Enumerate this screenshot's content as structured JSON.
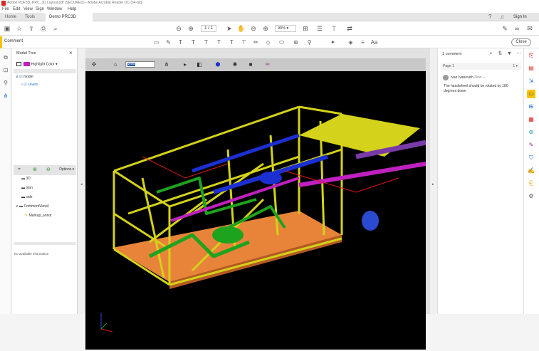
{
  "window": {
    "title": "Adobe PDF3D_PRC_3D Layout.pdf (SECURED) - Adobe Acrobat Reader DC (64-bit)",
    "accent": "#d9261c"
  },
  "menu": [
    "File",
    "Edit",
    "View",
    "Sign",
    "Window",
    "Help"
  ],
  "tabs": [
    {
      "label": "Home"
    },
    {
      "label": "Tools"
    },
    {
      "label": "Demo PRC3D Befo..."
    }
  ],
  "header": {
    "signin": "Sign In"
  },
  "toolbar": {
    "page_current": "1",
    "page_total": "/ 1",
    "zoom": "90%"
  },
  "commentbar": {
    "label": "Comment",
    "close": "Close",
    "accent": "#f7c200"
  },
  "modeltree": {
    "title": "Model Tree",
    "color_label": "Highlight Color",
    "tree": [
      {
        "label": "model",
        "level": 0,
        "checked": true
      },
      {
        "label": "Levels",
        "level": 1,
        "checked": true
      }
    ],
    "views_label": "Options",
    "views": [
      {
        "label": "3D"
      },
      {
        "label": "plan"
      },
      {
        "label": "side"
      },
      {
        "label": "CommentView4"
      },
      {
        "label": "Markup_annot"
      }
    ],
    "info": "No available information"
  },
  "pdf3d": {
    "view_select": "Views"
  },
  "comments": {
    "count_label": "1 comment",
    "page_label": "Page 1",
    "page_count": "1",
    "author": "Ivan Ivanovich",
    "time": "Now",
    "text": "The handwheel should be rotated by 180 degrees down"
  },
  "colors": {
    "viewport_bg": "#000000",
    "steel": "#d4d21a",
    "deck": "#e8843a",
    "pipe_green": "#1ea31e",
    "pipe_blue": "#1c2fd1",
    "pipe_magenta": "#c020c0",
    "rail_red": "#e01818",
    "purple": "#7a3aa8"
  }
}
